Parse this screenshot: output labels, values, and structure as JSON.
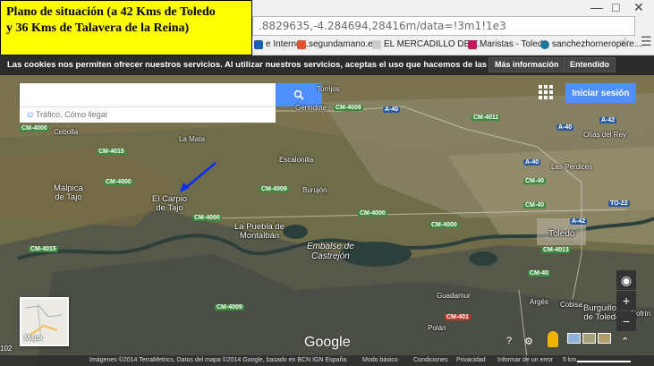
{
  "caption": {
    "line1": "Plano de situación (a 42 Kms de Toledo",
    "line2": "y 36 Kms de Talavera de la Reina)"
  },
  "browser": {
    "url": ".8829635,-4.284694,28416m/data=!3m1!1e3",
    "bookmarks": [
      {
        "label": "e Internet...",
        "color": "#1b5fb0"
      },
      {
        "label": "segundamano.es",
        "color": "#e0542b"
      },
      {
        "label": "EL MERCADILLO DE T...",
        "color": "#cccccc"
      },
      {
        "label": "Maristas - Toledo",
        "color": "#c2185b"
      },
      {
        "label": "sanchezhorneropere...",
        "color": "#21759b"
      }
    ]
  },
  "cookie_bar": {
    "text": "Las cookies nos permiten ofrecer nuestros servicios. Al utilizar nuestros servicios, aceptas el uso que hacemos de las cookies.",
    "more_info": "Más información",
    "accept": "Entendido"
  },
  "map": {
    "search_placeholder": "",
    "route_text": "Tráfico, Cómo llegar",
    "signin": "Iniciar sesión",
    "minimap_label": "Mapa",
    "logo": "Google",
    "side_number": "102",
    "places": {
      "torrijos": "Torrijos",
      "gerindote": "Gerindote",
      "cebolla": "Cebolla",
      "la_mata": "La Mata",
      "escalonilla": "Escalonilla",
      "malpica_1": "Malpica",
      "malpica_2": "de Tajo",
      "carpio_1": "El Carpio",
      "carpio_2": "de Tajo",
      "burujon": "Burujón",
      "puebla_1": "La Puebla de",
      "puebla_2": "Montalbán",
      "embalse_1": "Embalse de",
      "embalse_2": "Castrejón",
      "toledo": "Toledo",
      "olias": "Olías del Rey",
      "perdices": "Las Perdices",
      "guadamur": "Guadamur",
      "arges": "Argés",
      "cobisa": "Cobisa",
      "burguillos_1": "Burguillos",
      "burguillos_2": "de Toledo",
      "polan": "Polán",
      "ajofrin": "Ajofrín"
    },
    "roads": {
      "cm4000_a": "CM-4000",
      "cm4015": "CM-4015",
      "cm4000_b": "CM-4000",
      "cm4009_a": "CM-4009",
      "a40_a": "A-40",
      "cm4011": "CM-4011",
      "a42_a": "A-42",
      "a40_b": "A-40",
      "cm4009_b": "CM-4009",
      "cm4000_c": "CM-4000",
      "cm4000_d": "CM-4000",
      "a40_c": "A-40",
      "cm40_a": "CM-40",
      "cm40_b": "CM-40",
      "a42_b": "A-42",
      "to22": "TO-22",
      "cm4000_e": "CM-4000",
      "cm4015_b": "CM-4015",
      "cm4013": "CM-4013",
      "cm4009_c": "CM-4009",
      "cm401": "CM-401",
      "cm40_c": "CM-40"
    },
    "scale": "5 km",
    "bottom": {
      "imagery": "Imágenes ©2014 TerraMetrics, Datos del mapa ©2014 Google, basado en BCN IGN España",
      "basic": "Modo básico",
      "terms": "Condiciones",
      "privacy": "Privacidad",
      "report": "Informar de un error"
    }
  }
}
